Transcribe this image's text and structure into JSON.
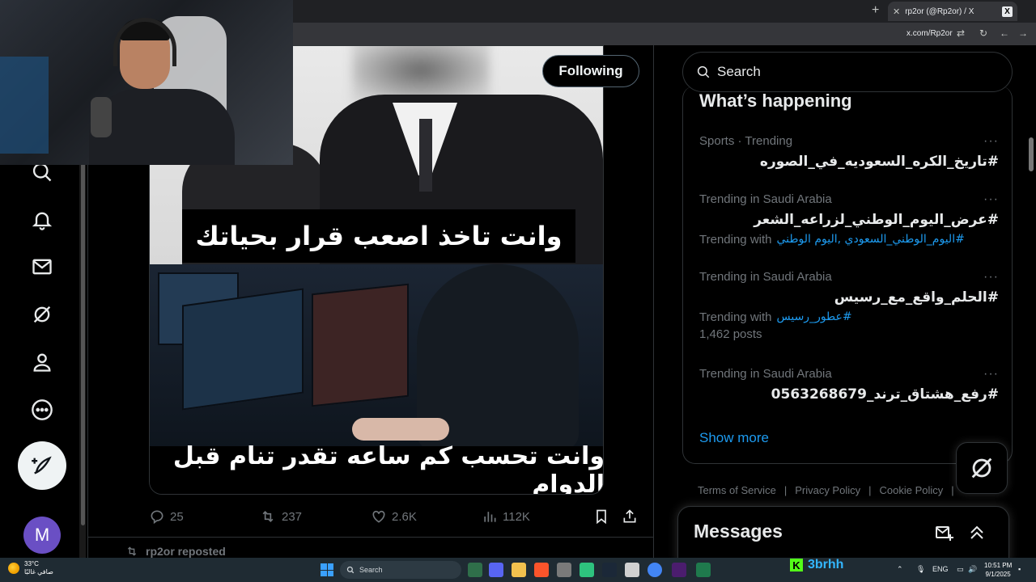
{
  "browser": {
    "tab_title": "rp2or (@Rp2or) / X",
    "tab_favicon": "X",
    "new_tab": "+",
    "address": "x.com/Rp2or"
  },
  "profile": {
    "following_label": "Following",
    "avatar_letter": "M"
  },
  "tweet": {
    "caption_top": "وانت تاخذ اصعب قرار بحياتك",
    "caption_bottom": "وانت تحسب كم ساعه تقدر تنام قبل الدوام",
    "replies": "25",
    "reposts": "237",
    "likes": "2.6K",
    "views": "112K",
    "next_reposted_by": "rp2or reposted"
  },
  "search": {
    "placeholder": "Search"
  },
  "trends": {
    "title": "What’s happening",
    "items": [
      {
        "category": "Sports · Trending",
        "tag": "#تاريخ_الكره_السعوديه_في_الصوره",
        "more": "···"
      },
      {
        "category": "Trending in Saudi Arabia",
        "tag": "#عرض_اليوم_الوطني_لزراعه_الشعر",
        "with_label": "Trending with",
        "with_links": "#اليوم_الوطني_السعودي ,اليوم الوطني",
        "more": "···"
      },
      {
        "category": "Trending in Saudi Arabia",
        "tag": "#الحلم_واقع_مع_رسيس",
        "with_label": "Trending with",
        "with_links": "#عطور_رسيس",
        "posts": "1,462 posts",
        "more": "···"
      },
      {
        "category": "Trending in Saudi Arabia",
        "tag": "#رفع_هشتاق_ترند_0563268679",
        "more": "···"
      }
    ],
    "show_more": "Show more"
  },
  "footer": {
    "links": [
      "Terms of Service",
      "Privacy Policy",
      "Cookie Policy"
    ],
    "separator": "|"
  },
  "messages": {
    "title": "Messages"
  },
  "taskbar": {
    "temperature": "33°C",
    "weather_text": "صافي غالبًا",
    "search_label": "Search",
    "streamer_name": "3brhh",
    "streamer_logo": "K",
    "lang": "ENG",
    "time": "10:51 PM",
    "date": "9/1/2025"
  },
  "colors": {
    "accent": "#1d9bf0",
    "background": "#000000",
    "border": "#2f3336",
    "muted": "#71767b"
  }
}
